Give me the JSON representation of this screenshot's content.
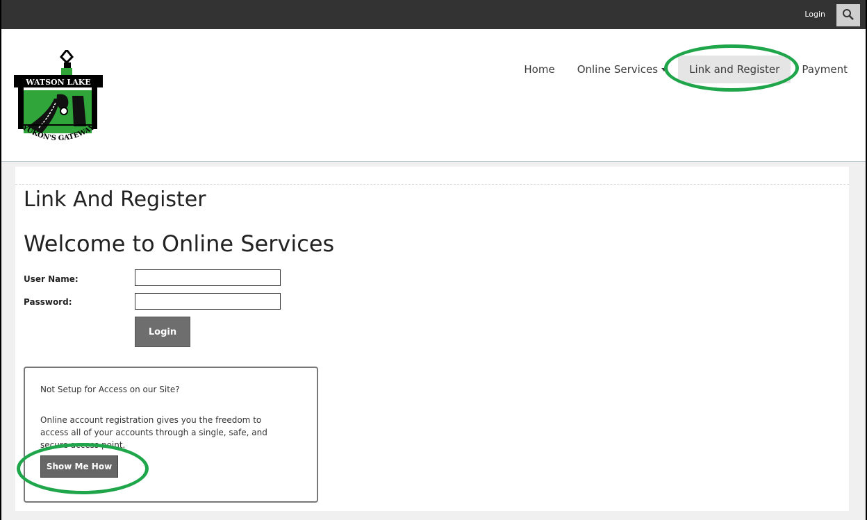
{
  "topbar": {
    "login_label": "Login",
    "search_icon": "search-icon"
  },
  "header": {
    "logo": {
      "top_text": "WATSON LAKE",
      "bottom_text": "YUKON'S GATEWAY",
      "colors": {
        "green": "#2fa53a",
        "black": "#000000"
      }
    },
    "nav": {
      "home": "Home",
      "online_services": "Online Services",
      "link_register": "Link and Register",
      "payment": "Payment"
    }
  },
  "main": {
    "page_title": "Link And Register",
    "welcome": "Welcome to Online Services",
    "form": {
      "username_label": "User Name:",
      "username_value": "",
      "password_label": "Password:",
      "password_value": "",
      "login_button": "Login"
    },
    "info": {
      "title": "Not Setup for Access on our Site?",
      "body": "Online account registration gives you the freedom to access all of your accounts through a single, safe, and secure access point.",
      "button": "Show Me How"
    }
  },
  "colors": {
    "topbar": "#333333",
    "highlight": "#1fa54a",
    "button": "#6e6e6e"
  }
}
